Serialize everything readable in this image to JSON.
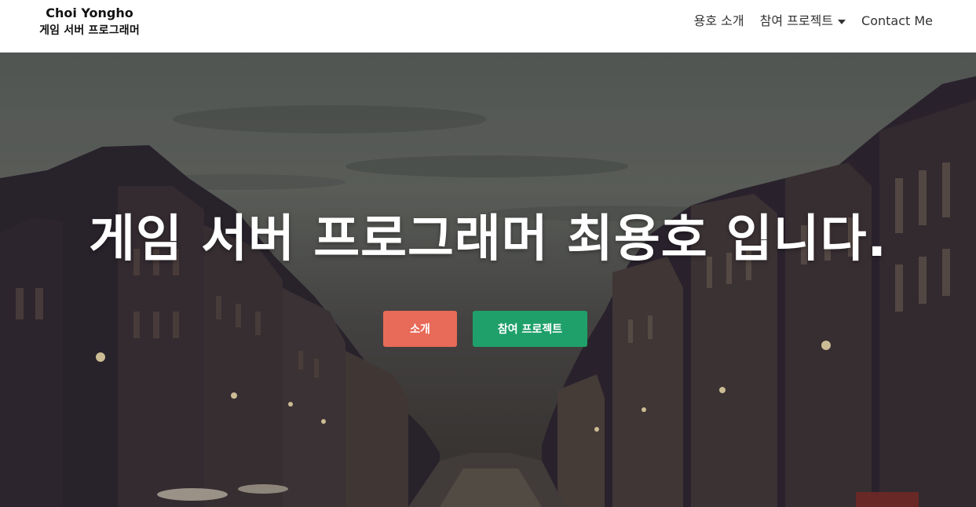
{
  "navbar": {
    "brand_name": "Choi Yongho",
    "brand_sub": "게임 서버 프로그래머",
    "items": [
      {
        "label": "용호 소개"
      },
      {
        "label": "참여 프로젝트",
        "has_dropdown": true
      },
      {
        "label": "Contact Me"
      }
    ]
  },
  "hero": {
    "title": "게임 서버 프로그래머 최용호 입니다.",
    "buttons": {
      "about_label": "소개",
      "projects_label": "참여 프로젝트"
    }
  },
  "colors": {
    "about_button": "#e86a58",
    "projects_button": "#1fa06a",
    "navbar_bg": "#ffffff"
  }
}
